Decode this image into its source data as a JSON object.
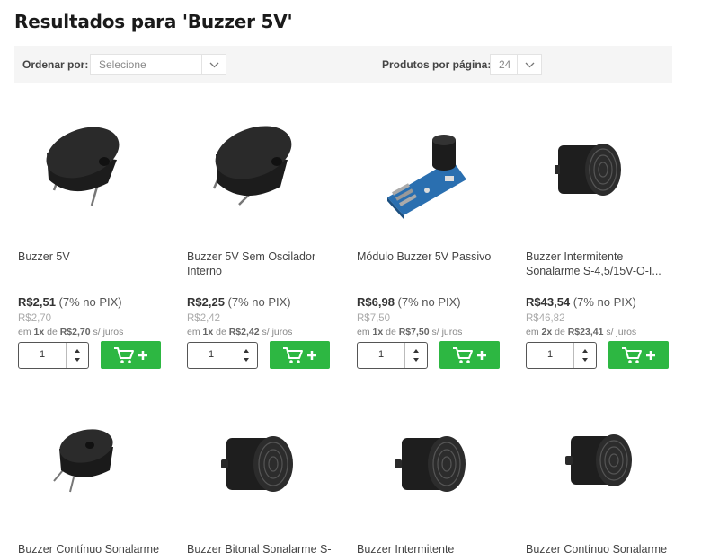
{
  "page": {
    "title": "Resultados para 'Buzzer 5V'"
  },
  "toolbar": {
    "sort_label": "Ordenar por:",
    "sort_value": "Selecione",
    "per_page_label": "Produtos por página:",
    "per_page_value": "24"
  },
  "products": [
    {
      "name": "Buzzer 5V",
      "price": "R$2,51",
      "pix": "(7% no PIX)",
      "old_price": "R$2,70",
      "inst_pre": "em ",
      "inst_times": "1x",
      "inst_mid": " de ",
      "inst_value": "R$2,70",
      "inst_post": " s/ juros",
      "qty": "1",
      "image": "buzzer-pcb-icon"
    },
    {
      "name": "Buzzer 5V Sem Oscilador Interno",
      "price": "R$2,25",
      "pix": "(7% no PIX)",
      "old_price": "R$2,42",
      "inst_pre": "em ",
      "inst_times": "1x",
      "inst_mid": " de ",
      "inst_value": "R$2,42",
      "inst_post": " s/ juros",
      "qty": "1",
      "image": "buzzer-pcb-icon"
    },
    {
      "name": "Módulo Buzzer 5V Passivo",
      "price": "R$6,98",
      "pix": "(7% no PIX)",
      "old_price": "R$7,50",
      "inst_pre": "em ",
      "inst_times": "1x",
      "inst_mid": " de ",
      "inst_value": "R$7,50",
      "inst_post": " s/ juros",
      "qty": "1",
      "image": "buzzer-module-icon"
    },
    {
      "name": "Buzzer Intermitente Sonalarme S-4,5/15V-O-I...",
      "price": "R$43,54",
      "pix": "(7% no PIX)",
      "old_price": "R$46,82",
      "inst_pre": "em ",
      "inst_times": "2x",
      "inst_mid": " de ",
      "inst_value": "R$23,41",
      "inst_post": " s/ juros",
      "qty": "1",
      "image": "sonalarme-icon"
    },
    {
      "name": "Buzzer Contínuo Sonalarme",
      "image": "buzzer-small-icon"
    },
    {
      "name": "Buzzer Bitonal Sonalarme S-",
      "image": "sonalarme-icon"
    },
    {
      "name": "Buzzer Intermitente",
      "image": "sonalarme-icon"
    },
    {
      "name": "Buzzer Contínuo Sonalarme",
      "image": "sonalarme-icon"
    }
  ]
}
